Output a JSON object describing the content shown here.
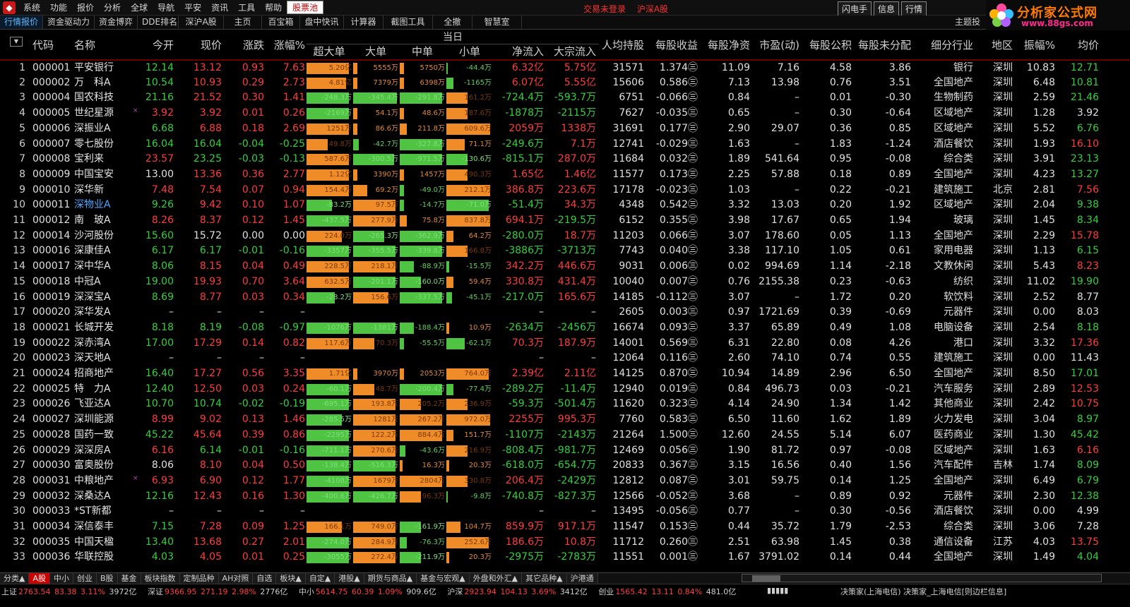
{
  "menu": [
    "系统",
    "功能",
    "报价",
    "分析",
    "全球",
    "导航",
    "平安",
    "资讯",
    "工具",
    "帮助",
    "股票池"
  ],
  "status_msgs": [
    "交易未登录",
    "沪深A股"
  ],
  "top_buttons": [
    "闪电手",
    "信息",
    "行情"
  ],
  "brand": {
    "title": "分析家公式网",
    "url": "www.88gs.com"
  },
  "tabs": [
    "行情报价",
    "资金驱动力",
    "资金博弈",
    "DDE排名",
    "深沪A股",
    "主页",
    "百宝箱",
    "盘中快讯",
    "计算器",
    "截图工具",
    "全撤",
    "智慧室"
  ],
  "tab_right": "主题投",
  "day_header": "当日",
  "columns": [
    "代码",
    "名称",
    "今开",
    "现价",
    "涨跌",
    "涨幅%",
    "超大单",
    "大单",
    "中单",
    "小单",
    "净流入",
    "大宗流入",
    "人均持股",
    "每股收益",
    "每股净资",
    "市盈(动)",
    "每股公积",
    "每股未分配",
    "细分行业",
    "地区",
    "振幅%",
    "均价"
  ],
  "rows": [
    [
      "1",
      "000001",
      "平安银行",
      "",
      "12.14",
      "13.12",
      "0.93",
      "7.63",
      "5.20亿",
      "5555万",
      "5750万",
      "-44.4万",
      "6.32亿",
      "5.75亿",
      "31571",
      "1.374㊂",
      "11.09",
      "7.16",
      "4.58",
      "3.86",
      "银行",
      "深圳",
      "10.83",
      "12.71"
    ],
    [
      "2",
      "000002",
      "万　科A",
      "",
      "10.54",
      "10.93",
      "0.29",
      "2.73",
      "4.81亿",
      "7379万",
      "6398万",
      "-1165万",
      "6.07亿",
      "5.55亿",
      "15606",
      "0.586㊂",
      "7.13",
      "13.98",
      "0.76",
      "3.51",
      "全国地产",
      "深圳",
      "6.48",
      "10.81"
    ],
    [
      "3",
      "000004",
      "国农科技",
      "",
      "21.16",
      "21.52",
      "0.30",
      "1.41",
      "-248.3万",
      "-345.4万",
      "-291.8万",
      "161.2万",
      "-724.4万",
      "-593.7万",
      "6751",
      "-0.066㊂",
      "0.84",
      "–",
      "0.01",
      "-0.30",
      "生物制药",
      "深圳",
      "2.59",
      "21.46"
    ],
    [
      "4",
      "000005",
      "世纪星源",
      "×",
      "3.92",
      "3.92",
      "0.01",
      "0.26",
      "-2169万",
      "54.1万",
      "48.6万",
      "187.6万",
      "-1878万",
      "-2115万",
      "7627",
      "-0.035㊂",
      "0.65",
      "–",
      "0.30",
      "-0.64",
      "区域地产",
      "深圳",
      "1.28",
      "3.92"
    ],
    [
      "5",
      "000006",
      "深振业A",
      "",
      "6.68",
      "6.88",
      "0.18",
      "2.69",
      "1251万",
      "86.6万",
      "211.8万",
      "609.6万",
      "2059万",
      "1338万",
      "31691",
      "0.177㊂",
      "2.90",
      "29.07",
      "0.36",
      "0.85",
      "区域地产",
      "深圳",
      "5.52",
      "6.76"
    ],
    [
      "6",
      "000007",
      "零七股份",
      "",
      "16.04",
      "16.04",
      "-0.04",
      "-0.25",
      "49.8万",
      "-42.7万",
      "-327.8万",
      "71.1万",
      "-249.6万",
      "7.1万",
      "12741",
      "-0.029㊂",
      "1.63",
      "–",
      "1.83",
      "-1.24",
      "酒店餐饮",
      "深圳",
      "1.93",
      "16.10"
    ],
    [
      "7",
      "000008",
      "宝利来",
      "",
      "23.57",
      "23.25",
      "-0.03",
      "-0.13",
      "587.6万",
      "-300.5万",
      "-971.5万",
      "-130.6万",
      "-815.1万",
      "287.0万",
      "11684",
      "0.032㊂",
      "1.89",
      "541.64",
      "0.95",
      "-0.08",
      "综合类",
      "深圳",
      "3.91",
      "23.13"
    ],
    [
      "8",
      "000009",
      "中国宝安",
      "",
      "13.00",
      "13.36",
      "0.36",
      "2.77",
      "1.12亿",
      "3390万",
      "1457万",
      "490.3万",
      "1.65亿",
      "1.46亿",
      "11577",
      "0.173㊂",
      "2.25",
      "57.88",
      "0.18",
      "0.89",
      "全国地产",
      "深圳",
      "4.23",
      "13.27"
    ],
    [
      "9",
      "000010",
      "深华新",
      "",
      "7.48",
      "7.54",
      "0.07",
      "0.94",
      "154.4万",
      "69.2万",
      "-49.0万",
      "212.1万",
      "386.8万",
      "223.6万",
      "17178",
      "-0.023㊂",
      "1.03",
      "–",
      "0.22",
      "-0.21",
      "建筑施工",
      "北京",
      "2.81",
      "7.56"
    ],
    [
      "10",
      "000011",
      "深物业A",
      "",
      "9.26",
      "9.42",
      "0.10",
      "1.07",
      "-83.2万",
      "97.5万",
      "-14.7万",
      "-71.0万",
      "-51.4万",
      "34.3万",
      "4348",
      "0.542㊂",
      "3.32",
      "13.03",
      "0.20",
      "1.92",
      "区域地产",
      "深圳",
      "2.04",
      "9.38"
    ],
    [
      "11",
      "000012",
      "南　玻A",
      "",
      "8.26",
      "8.37",
      "0.12",
      "1.45",
      "-437.5万",
      "277.9万",
      "75.8万",
      "837.8万",
      "694.1万",
      "-219.5万",
      "6152",
      "0.355㊂",
      "3.98",
      "17.67",
      "0.65",
      "1.94",
      "玻璃",
      "深圳",
      "1.45",
      "8.34"
    ],
    [
      "12",
      "000014",
      "沙河股份",
      "",
      "15.60",
      "15.72",
      "0.00",
      "0.00",
      "224.0万",
      "-265.3万",
      "-362.9万",
      "64.2万",
      "-280.0万",
      "18.7万",
      "11203",
      "0.066㊂",
      "3.07",
      "178.60",
      "0.05",
      "1.13",
      "全国地产",
      "深圳",
      "2.29",
      "15.78"
    ],
    [
      "13",
      "000016",
      "深康佳A",
      "",
      "6.17",
      "6.17",
      "-0.01",
      "-0.16",
      "-3357万",
      "-355.5万",
      "-339.8万",
      "166.8万",
      "-3886万",
      "-3713万",
      "7743",
      "0.040㊂",
      "3.38",
      "117.10",
      "1.05",
      "0.61",
      "家用电器",
      "深圳",
      "1.13",
      "6.15"
    ],
    [
      "14",
      "000017",
      "深中华A",
      "",
      "8.06",
      "8.15",
      "0.04",
      "0.49",
      "228.5万",
      "218.1万",
      "-88.9万",
      "-15.5万",
      "342.2万",
      "446.6万",
      "9031",
      "0.006㊂",
      "0.02",
      "994.69",
      "1.14",
      "-2.18",
      "文教休闲",
      "深圳",
      "5.43",
      "8.23"
    ],
    [
      "15",
      "000018",
      "中冠A",
      "",
      "19.00",
      "19.93",
      "0.70",
      "3.64",
      "632.5万",
      "-201.1万",
      "-160.0万",
      "59.4万",
      "330.8万",
      "431.4万",
      "10040",
      "0.007㊂",
      "0.76",
      "2155.38",
      "0.23",
      "-0.63",
      "纺织",
      "深圳",
      "11.02",
      "19.90"
    ],
    [
      "16",
      "000019",
      "深深宝A",
      "",
      "8.69",
      "8.77",
      "0.03",
      "0.34",
      "-28.2万",
      "156.6万",
      "-337.5万",
      "-45.1万",
      "-217.0万",
      "165.6万",
      "14185",
      "-0.112㊂",
      "3.07",
      "–",
      "1.72",
      "0.20",
      "软饮料",
      "深圳",
      "2.52",
      "8.77"
    ],
    [
      "17",
      "000020",
      "深华发A",
      "",
      "–",
      "–",
      "–",
      "–",
      "",
      "",
      "",
      "",
      "–",
      "–",
      "2605",
      "0.003㊂",
      "0.97",
      "1721.69",
      "0.39",
      "-0.69",
      "元器件",
      "深圳",
      "0.00",
      "8.03"
    ],
    [
      "18",
      "000021",
      "长城开发",
      "",
      "8.18",
      "8.19",
      "-0.08",
      "-0.97",
      "-1076万",
      "-1381万",
      "-188.4万",
      "10.9万",
      "-2634万",
      "-2456万",
      "16674",
      "0.093㊂",
      "3.37",
      "65.89",
      "0.49",
      "1.08",
      "电脑设备",
      "深圳",
      "2.54",
      "8.18"
    ],
    [
      "19",
      "000022",
      "深赤湾A",
      "",
      "17.00",
      "17.29",
      "0.14",
      "0.82",
      "117.6万",
      "70.3万",
      "-55.5万",
      "-62.1万",
      "70.3万",
      "187.9万",
      "14001",
      "0.569㊂",
      "6.31",
      "22.80",
      "0.08",
      "4.26",
      "港口",
      "深圳",
      "3.32",
      "17.36"
    ],
    [
      "20",
      "000023",
      "深天地A",
      "",
      "–",
      "–",
      "–",
      "–",
      "",
      "",
      "",
      "",
      "–",
      "–",
      "12064",
      "0.116㊂",
      "2.60",
      "74.10",
      "0.74",
      "0.55",
      "建筑施工",
      "深圳",
      "0.00",
      "11.43"
    ],
    [
      "21",
      "000024",
      "招商地产",
      "",
      "16.40",
      "17.27",
      "0.56",
      "3.35",
      "1.71亿",
      "3970万",
      "2053万",
      "764.0万",
      "2.39亿",
      "2.11亿",
      "14125",
      "0.870㊂",
      "10.94",
      "14.89",
      "2.96",
      "6.50",
      "全国地产",
      "深圳",
      "8.50",
      "17.01"
    ],
    [
      "22",
      "000025",
      "特　力A",
      "",
      "12.40",
      "12.50",
      "0.03",
      "0.24",
      "-60.1万",
      "48.7万",
      "-200.4万",
      "-77.4万",
      "-289.2万",
      "-11.4万",
      "12940",
      "0.019㊂",
      "0.84",
      "496.73",
      "0.03",
      "-0.21",
      "汽车服务",
      "深圳",
      "2.89",
      "12.53"
    ],
    [
      "23",
      "000026",
      "飞亚达A",
      "",
      "10.70",
      "10.74",
      "-0.02",
      "-0.19",
      "-695.1万",
      "193.8万",
      "205.2万",
      "236.9万",
      "-59.3万",
      "-501.4万",
      "11620",
      "0.323㊂",
      "4.14",
      "24.90",
      "1.34",
      "1.42",
      "其他商业",
      "深圳",
      "2.42",
      "10.75"
    ],
    [
      "24",
      "000027",
      "深圳能源",
      "",
      "8.99",
      "9.02",
      "0.13",
      "1.46",
      "-285.5万",
      "1281万",
      "267.2万",
      "972.0万",
      "2255万",
      "995.3万",
      "7760",
      "0.583㊂",
      "6.50",
      "11.60",
      "1.62",
      "1.89",
      "火力发电",
      "深圳",
      "3.04",
      "8.97"
    ],
    [
      "25",
      "000028",
      "国药一致",
      "",
      "45.22",
      "45.64",
      "0.39",
      "0.86",
      "-2295万",
      "122.2万",
      "884.4万",
      "151.7万",
      "-1107万",
      "-2143万",
      "21264",
      "1.500㊂",
      "12.60",
      "24.55",
      "5.14",
      "6.07",
      "医药商业",
      "深圳",
      "1.30",
      "45.42"
    ],
    [
      "26",
      "000029",
      "深深房A",
      "",
      "6.16",
      "6.14",
      "-0.01",
      "-0.16",
      "-711.1万",
      "270.6万",
      "-43.6万",
      "216.9万",
      "-808.4万",
      "-981.7万",
      "12469",
      "0.056㊂",
      "1.90",
      "81.72",
      "0.97",
      "-0.08",
      "区域地产",
      "深圳",
      "1.63",
      "6.16"
    ],
    [
      "27",
      "000030",
      "富奥股份",
      "",
      "8.06",
      "8.10",
      "0.04",
      "0.50",
      "-138.4万",
      "-516.3万",
      "16.3万",
      "20.3万",
      "-618.0万",
      "-654.7万",
      "20833",
      "0.367㊂",
      "3.15",
      "16.56",
      "0.40",
      "1.56",
      "汽车配件",
      "吉林",
      "1.74",
      "8.09"
    ],
    [
      "28",
      "000031",
      "中粮地产",
      "×",
      "6.93",
      "6.90",
      "0.12",
      "1.77",
      "-4108万",
      "1679万",
      "2804万",
      "330.8万",
      "206.4万",
      "-2429万",
      "12812",
      "0.087㊂",
      "3.01",
      "59.75",
      "0.14",
      "1.25",
      "全国地产",
      "深圳",
      "6.49",
      "6.79"
    ],
    [
      "29",
      "000032",
      "深桑达A",
      "",
      "12.16",
      "12.43",
      "0.16",
      "1.30",
      "-400.6万",
      "-426.7万",
      "96.3万",
      "-9.8万",
      "-740.8万",
      "-827.3万",
      "12566",
      "-0.052㊂",
      "3.68",
      "–",
      "0.89",
      "0.92",
      "元器件",
      "深圳",
      "2.30",
      "12.38"
    ],
    [
      "30",
      "000033",
      "*ST新都",
      "",
      "–",
      "–",
      "–",
      "–",
      "",
      "",
      "",
      "",
      "–",
      "–",
      "13495",
      "-0.056㊂",
      "0.77",
      "–",
      "0.30",
      "-0.56",
      "酒店餐饮",
      "深圳",
      "0.00",
      "4.99"
    ],
    [
      "31",
      "000034",
      "深信泰丰",
      "",
      "7.15",
      "7.28",
      "0.09",
      "1.25",
      "166.1万",
      "749.0万",
      "-161.9万",
      "104.7万",
      "859.9万",
      "917.1万",
      "11547",
      "0.153㊂",
      "0.44",
      "35.72",
      "1.79",
      "-2.53",
      "综合类",
      "深圳",
      "3.06",
      "7.28"
    ],
    [
      "32",
      "000035",
      "中国天楹",
      "",
      "13.40",
      "13.68",
      "0.27",
      "2.01",
      "-274.0万",
      "284.9万",
      "-76.3万",
      "252.6万",
      "186.6万",
      "10.8万",
      "11712",
      "0.260㊂",
      "2.51",
      "63.98",
      "1.45",
      "0.38",
      "通信设备",
      "江苏",
      "4.03",
      "13.75"
    ],
    [
      "33",
      "000036",
      "华联控股",
      "",
      "4.03",
      "4.05",
      "0.01",
      "0.25",
      "-3055万",
      "272.4万",
      "-211.9万",
      "20.3万",
      "-2975万",
      "-2783万",
      "11551",
      "0.001㊂",
      "1.67",
      "3791.02",
      "0.14",
      "0.44",
      "全国地产",
      "深圳",
      "1.49",
      "4.04"
    ]
  ],
  "bars": [
    [
      [
        "o",
        60
      ],
      [
        "o",
        6
      ],
      [
        "o",
        6
      ],
      [
        "g",
        1
      ]
    ],
    [
      [
        "o",
        56
      ],
      [
        "o",
        6
      ],
      [
        "o",
        6
      ],
      [
        "g",
        10
      ]
    ],
    [
      [
        "g",
        60
      ],
      [
        "g",
        62
      ],
      [
        "g",
        60
      ],
      [
        "o",
        30
      ]
    ],
    [
      [
        "g",
        60
      ],
      [
        "o",
        6
      ],
      [
        "o",
        6
      ],
      [
        "o",
        30
      ]
    ],
    [
      [
        "o",
        60
      ],
      [
        "o",
        6
      ],
      [
        "o",
        10
      ],
      [
        "o",
        62
      ]
    ],
    [
      [
        "o",
        30
      ],
      [
        "g",
        8
      ],
      [
        "g",
        60
      ],
      [
        "o",
        26
      ]
    ],
    [
      [
        "o",
        60
      ],
      [
        "g",
        58
      ],
      [
        "g",
        60
      ],
      [
        "g",
        30
      ]
    ],
    [
      [
        "o",
        60
      ],
      [
        "o",
        6
      ],
      [
        "o",
        6
      ],
      [
        "o",
        30
      ]
    ],
    [
      [
        "o",
        60
      ],
      [
        "o",
        20
      ],
      [
        "g",
        6
      ],
      [
        "o",
        62
      ]
    ],
    [
      [
        "g",
        36
      ],
      [
        "o",
        60
      ],
      [
        "g",
        6
      ],
      [
        "g",
        60
      ]
    ],
    [
      [
        "g",
        60
      ],
      [
        "o",
        60
      ],
      [
        "o",
        10
      ],
      [
        "o",
        62
      ]
    ],
    [
      [
        "o",
        50
      ],
      [
        "g",
        44
      ],
      [
        "g",
        60
      ],
      [
        "o",
        10
      ]
    ],
    [
      [
        "g",
        60
      ],
      [
        "g",
        60
      ],
      [
        "g",
        60
      ],
      [
        "o",
        30
      ]
    ],
    [
      [
        "o",
        60
      ],
      [
        "o",
        60
      ],
      [
        "g",
        20
      ],
      [
        "g",
        4
      ]
    ],
    [
      [
        "o",
        60
      ],
      [
        "g",
        60
      ],
      [
        "g",
        30
      ],
      [
        "o",
        10
      ]
    ],
    [
      [
        "g",
        40
      ],
      [
        "o",
        50
      ],
      [
        "g",
        60
      ],
      [
        "g",
        8
      ]
    ],
    [],
    [
      [
        "g",
        60
      ],
      [
        "g",
        60
      ],
      [
        "g",
        20
      ],
      [
        "o",
        4
      ]
    ],
    [
      [
        "o",
        60
      ],
      [
        "o",
        30
      ],
      [
        "g",
        6
      ],
      [
        "g",
        26
      ]
    ],
    [],
    [
      [
        "o",
        60
      ],
      [
        "o",
        6
      ],
      [
        "o",
        6
      ],
      [
        "o",
        60
      ]
    ],
    [
      [
        "g",
        60
      ],
      [
        "o",
        30
      ],
      [
        "g",
        60
      ],
      [
        "g",
        10
      ]
    ],
    [
      [
        "g",
        60
      ],
      [
        "o",
        60
      ],
      [
        "o",
        30
      ],
      [
        "o",
        30
      ]
    ],
    [
      [
        "g",
        50
      ],
      [
        "o",
        60
      ],
      [
        "o",
        60
      ],
      [
        "o",
        62
      ]
    ],
    [
      [
        "g",
        60
      ],
      [
        "o",
        60
      ],
      [
        "o",
        60
      ],
      [
        "o",
        10
      ]
    ],
    [
      [
        "g",
        60
      ],
      [
        "o",
        60
      ],
      [
        "g",
        8
      ],
      [
        "o",
        30
      ]
    ],
    [
      [
        "g",
        60
      ],
      [
        "g",
        60
      ],
      [
        "o",
        4
      ],
      [
        "o",
        4
      ]
    ],
    [
      [
        "g",
        60
      ],
      [
        "o",
        60
      ],
      [
        "o",
        60
      ],
      [
        "o",
        30
      ]
    ],
    [
      [
        "g",
        60
      ],
      [
        "g",
        60
      ],
      [
        "o",
        30
      ],
      [
        "g",
        2
      ]
    ],
    [],
    [
      [
        "o",
        50
      ],
      [
        "o",
        60
      ],
      [
        "g",
        30
      ],
      [
        "o",
        20
      ]
    ],
    [
      [
        "g",
        60
      ],
      [
        "o",
        60
      ],
      [
        "g",
        10
      ],
      [
        "o",
        60
      ]
    ],
    [
      [
        "g",
        60
      ],
      [
        "o",
        60
      ],
      [
        "g",
        30
      ],
      [
        "o",
        4
      ]
    ]
  ],
  "bottom_tabs": [
    "分类▲",
    "A股",
    "中小",
    "创业",
    "B股",
    "基金",
    "板块指数",
    "定制品种",
    "AH对照",
    "自选",
    "板块▲",
    "自定▲",
    "港股▲",
    "期货与商品▲",
    "基金与宏观▲",
    "外盘和外汇▲",
    "其它品种▲",
    "沪港通"
  ],
  "statusbar": {
    "sh": [
      "上证",
      "2763.54",
      "83.38",
      "3.11%",
      "3972亿"
    ],
    "sz": [
      "深证",
      "9366.95",
      "271.19",
      "2.98%",
      "2776亿"
    ],
    "zx": [
      "中小",
      "5614.75",
      "60.39",
      "1.09%",
      "909.6亿"
    ],
    "hs": [
      "沪深",
      "2923.94",
      "104.13",
      "3.69%",
      "3412亿"
    ],
    "cy": [
      "创业",
      "1565.42",
      "13.11",
      "0.84%",
      "481.0亿"
    ],
    "right_text": "决策家(上海电信)  决策家_上海电信[则边栏信息]"
  }
}
